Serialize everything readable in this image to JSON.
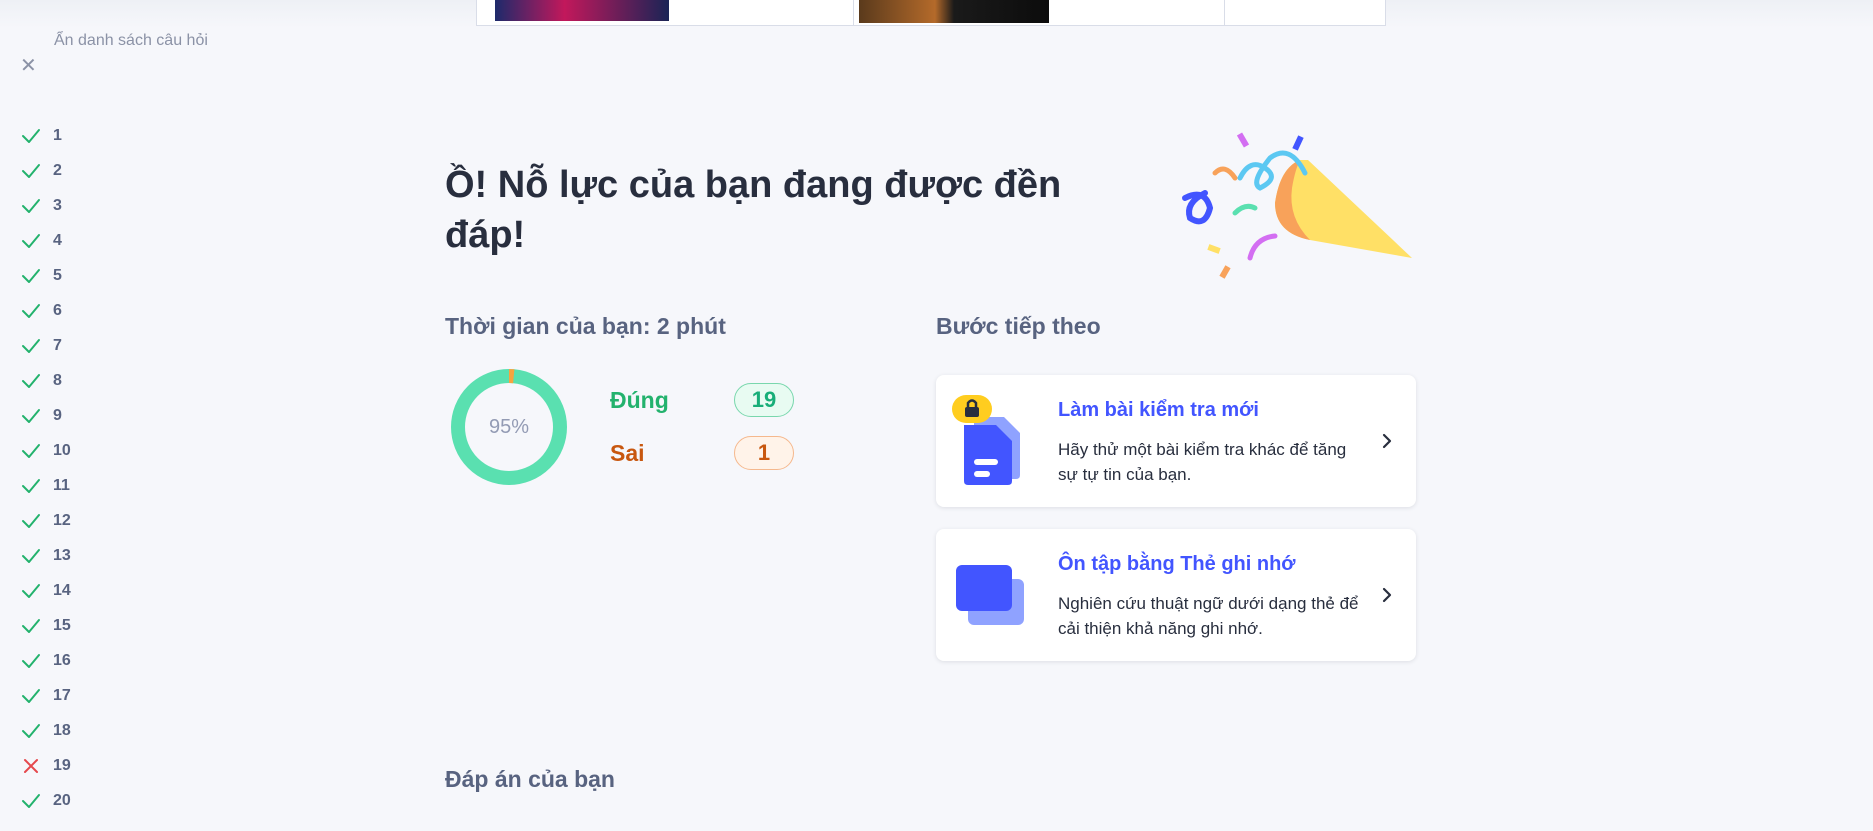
{
  "sidebar": {
    "hide_label": "Ẩn danh sách câu hỏi",
    "questions": [
      {
        "num": "1",
        "status": "correct"
      },
      {
        "num": "2",
        "status": "correct"
      },
      {
        "num": "3",
        "status": "correct"
      },
      {
        "num": "4",
        "status": "correct"
      },
      {
        "num": "5",
        "status": "correct"
      },
      {
        "num": "6",
        "status": "correct"
      },
      {
        "num": "7",
        "status": "correct"
      },
      {
        "num": "8",
        "status": "correct"
      },
      {
        "num": "9",
        "status": "correct"
      },
      {
        "num": "10",
        "status": "correct"
      },
      {
        "num": "11",
        "status": "correct"
      },
      {
        "num": "12",
        "status": "correct"
      },
      {
        "num": "13",
        "status": "correct"
      },
      {
        "num": "14",
        "status": "correct"
      },
      {
        "num": "15",
        "status": "correct"
      },
      {
        "num": "16",
        "status": "correct"
      },
      {
        "num": "17",
        "status": "correct"
      },
      {
        "num": "18",
        "status": "correct"
      },
      {
        "num": "19",
        "status": "wrong"
      },
      {
        "num": "20",
        "status": "correct"
      }
    ]
  },
  "result": {
    "heading": "Ồ! Nỗ lực của bạn đang được đền đáp!",
    "time_title": "Thời gian của bạn: 2 phút",
    "percent_label": "95%",
    "percent_value": 95,
    "correct_label": "Đúng",
    "correct_count": "19",
    "wrong_label": "Sai",
    "wrong_count": "1"
  },
  "next_steps": {
    "title": "Bước tiếp theo",
    "cards": [
      {
        "title": "Làm bài kiểm tra mới",
        "desc": "Hãy thử một bài kiểm tra khác để tăng sự tự tin của bạn.",
        "icon": "locked-document-icon"
      },
      {
        "title": "Ôn tập bằng Thẻ ghi nhớ",
        "desc": "Nghiên cứu thuật ngữ dưới dạng thẻ để cải thiện khả năng ghi nhớ.",
        "icon": "flashcards-icon"
      }
    ]
  },
  "answers_title": "Đáp án của bạn",
  "colors": {
    "correct": "#23b26d",
    "wrong": "#e5484d",
    "accent": "#4255ff",
    "donut_fill": "#5ae0b0",
    "donut_miss": "#f7a440"
  }
}
